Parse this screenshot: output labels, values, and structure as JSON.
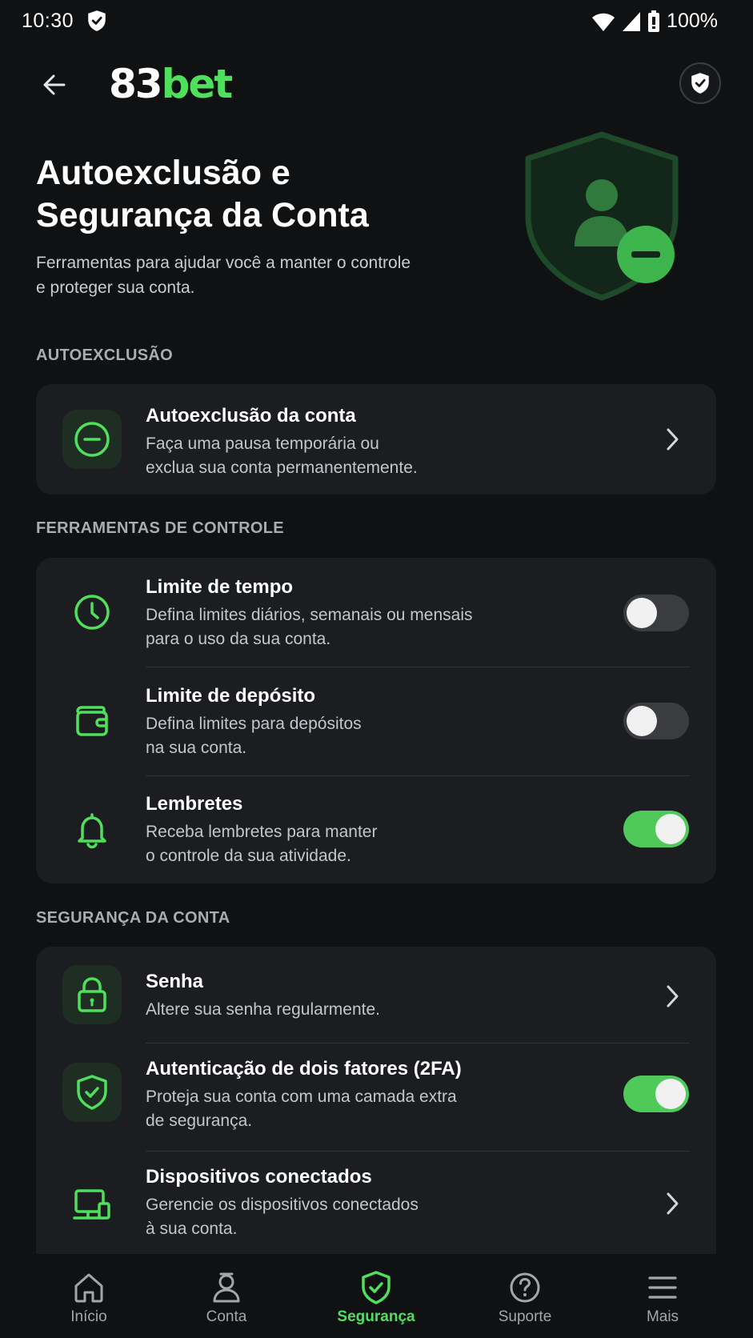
{
  "status_bar": {
    "time": "10:30",
    "battery": "100%"
  },
  "topbar": {
    "logo_num": "83",
    "logo_brand": "bet"
  },
  "hero": {
    "title_line1": "Autoexclusão e",
    "title_line2": "Segurança da Conta",
    "subtitle_line1": "Ferramentas para ajudar você a manter o controle",
    "subtitle_line2": "e proteger sua conta."
  },
  "sections": {
    "self_exclusion": {
      "label": "AUTOEXCLUSÃO",
      "items": [
        {
          "title": "Autoexclusão da conta",
          "desc_line1": "Faça uma pausa temporária ou",
          "desc_line2": "exclua sua conta permanentemente."
        }
      ]
    },
    "control_tools": {
      "label": "FERRAMENTAS DE CONTROLE",
      "items": [
        {
          "title": "Limite de tempo",
          "desc_line1": "Defina limites diários, semanais ou mensais",
          "desc_line2": "para o uso da sua conta.",
          "enabled": false
        },
        {
          "title": "Limite de depósito",
          "desc_line1": "Defina limites para depósitos",
          "desc_line2": "na sua conta.",
          "enabled": false
        },
        {
          "title": "Lembretes",
          "desc_line1": "Receba lembretes para manter",
          "desc_line2": "o controle da sua atividade.",
          "enabled": true
        }
      ]
    },
    "account_security": {
      "label": "SEGURANÇA DA CONTA",
      "items": [
        {
          "title": "Senha",
          "desc_line1": "Altere sua senha regularmente.",
          "desc_line2": ""
        },
        {
          "title": "Autenticação de dois fatores (2FA)",
          "desc_line1": "Proteja sua conta com uma camada extra",
          "desc_line2": "de segurança.",
          "enabled": true
        },
        {
          "title": "Dispositivos conectados",
          "desc_line1": "Gerencie os dispositivos conectados",
          "desc_line2": "à sua conta."
        }
      ]
    }
  },
  "bottom_nav": {
    "items": [
      {
        "label": "Início",
        "icon": "home-icon"
      },
      {
        "label": "Conta",
        "icon": "user-icon"
      },
      {
        "label": "Segurança",
        "icon": "shield-check-icon",
        "active": true
      },
      {
        "label": "Suporte",
        "icon": "help-icon"
      },
      {
        "label": "Mais",
        "icon": "menu-icon"
      }
    ]
  },
  "colors": {
    "accent": "#4ee05c",
    "background": "#0f1113",
    "card": "#1b1d21",
    "toggle_on": "#4ec95a",
    "toggle_off": "#3a3c40"
  }
}
